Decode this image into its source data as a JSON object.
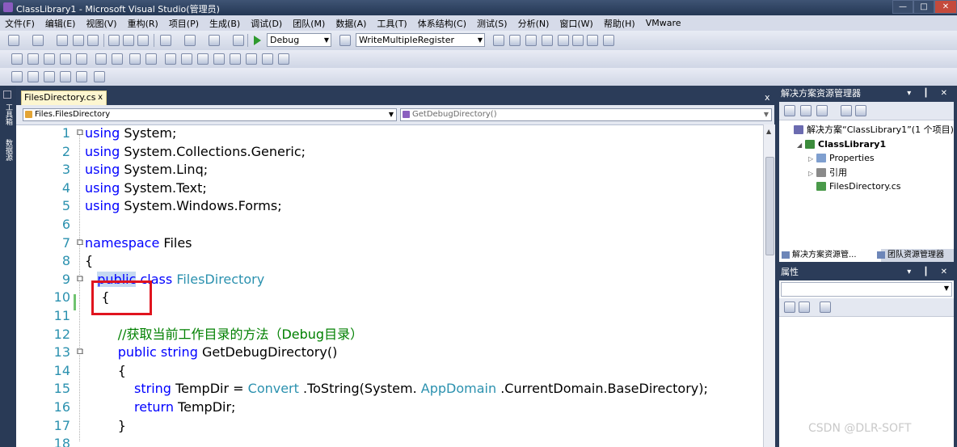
{
  "window": {
    "title": "ClassLibrary1 - Microsoft Visual Studio(管理员)",
    "minimize_glyph": "—",
    "maximize_glyph": "□",
    "close_glyph": "✕"
  },
  "menu": [
    "文件(F)",
    "编辑(E)",
    "视图(V)",
    "重构(R)",
    "项目(P)",
    "生成(B)",
    "调试(D)",
    "团队(M)",
    "数据(A)",
    "工具(T)",
    "体系结构(C)",
    "测试(S)",
    "分析(N)",
    "窗口(W)",
    "帮助(H)",
    "VMware"
  ],
  "toolbar": {
    "configuration": "Debug",
    "find_box": "WriteMultipleRegister"
  },
  "left_sidebar": {
    "toolbox_tab": "工具箱",
    "datasource_tab": "数据源"
  },
  "document": {
    "tab_label": "FilesDirectory.cs",
    "tab_close": "x",
    "class_dropdown": "Files.FilesDirectory",
    "member_dropdown": "GetDebugDirectory()"
  },
  "code_lines": [
    {
      "n": "1",
      "fold": "□",
      "segs": [
        [
          "kw",
          "using"
        ],
        [
          "",
          "System;"
        ]
      ]
    },
    {
      "n": "2",
      "fold": "",
      "segs": [
        [
          "kw",
          "using"
        ],
        [
          "",
          "System.Collections.Generic;"
        ]
      ]
    },
    {
      "n": "3",
      "fold": "",
      "segs": [
        [
          "kw",
          "using"
        ],
        [
          "",
          "System.Linq;"
        ]
      ]
    },
    {
      "n": "4",
      "fold": "",
      "segs": [
        [
          "kw",
          "using"
        ],
        [
          "",
          "System.Text;"
        ]
      ]
    },
    {
      "n": "5",
      "fold": "",
      "segs": [
        [
          "kw",
          "using"
        ],
        [
          "",
          "System.Windows.Forms;"
        ]
      ]
    },
    {
      "n": "6",
      "fold": "",
      "segs": []
    },
    {
      "n": "7",
      "fold": "□",
      "segs": [
        [
          "kw",
          "namespace"
        ],
        [
          "",
          "Files"
        ]
      ]
    },
    {
      "n": "8",
      "fold": "",
      "segs": [
        [
          "",
          "{"
        ]
      ]
    },
    {
      "n": "9",
      "fold": "□",
      "segs": [
        [
          "",
          "  "
        ],
        [
          "kw sel",
          "public"
        ],
        [
          "kw",
          "class"
        ],
        [
          "tp",
          "FilesDirectory"
        ]
      ]
    },
    {
      "n": "10",
      "fold": "",
      "segs": [
        [
          "",
          "    {"
        ]
      ]
    },
    {
      "n": "11",
      "fold": "",
      "segs": []
    },
    {
      "n": "12",
      "fold": "",
      "segs": [
        [
          "cm",
          "        //获取当前工作目录的方法（Debug目录）"
        ]
      ]
    },
    {
      "n": "13",
      "fold": "□",
      "segs": [
        [
          "kw",
          "        public"
        ],
        [
          "kw",
          "string"
        ],
        [
          "",
          "GetDebugDirectory()"
        ]
      ]
    },
    {
      "n": "14",
      "fold": "",
      "segs": [
        [
          "",
          "        {"
        ]
      ]
    },
    {
      "n": "15",
      "fold": "",
      "segs": [
        [
          "kw",
          "            string"
        ],
        [
          "",
          "TempDir ="
        ],
        [
          "tp",
          "Convert"
        ],
        [
          "",
          ".ToString(System."
        ],
        [
          "tp",
          "AppDomain"
        ],
        [
          "",
          ".CurrentDomain.BaseDirectory);"
        ]
      ]
    },
    {
      "n": "16",
      "fold": "",
      "segs": [
        [
          "kw",
          "            return"
        ],
        [
          "",
          "TempDir;"
        ]
      ]
    },
    {
      "n": "17",
      "fold": "",
      "segs": [
        [
          "",
          "        }"
        ]
      ]
    },
    {
      "n": "18",
      "fold": "",
      "segs": []
    }
  ],
  "solution_explorer": {
    "title": "解决方案资源管理器",
    "header_controls": "▾ ┃ ✕",
    "items": [
      {
        "label": "解决方案“ClassLibrary1”(1 个项目)",
        "indent": 0,
        "twisty": "",
        "icon": "#6b6bb0"
      },
      {
        "label": "ClassLibrary1",
        "indent": 1,
        "twisty": "◢",
        "icon": "#3c8c3c",
        "bold": true
      },
      {
        "label": "Properties",
        "indent": 2,
        "twisty": "▷",
        "icon": "#7f9fcf"
      },
      {
        "label": "引用",
        "indent": 2,
        "twisty": "▷",
        "icon": "#8a8a8a"
      },
      {
        "label": "FilesDirectory.cs",
        "indent": 2,
        "twisty": "",
        "icon": "#4a9a4a"
      }
    ],
    "tab_active": "解决方案资源管...",
    "tab_other": "团队资源管理器"
  },
  "properties": {
    "title": "属性",
    "header_controls": "▾ ┃ ✕"
  },
  "watermark": "CSDN @DLR-SOFT"
}
